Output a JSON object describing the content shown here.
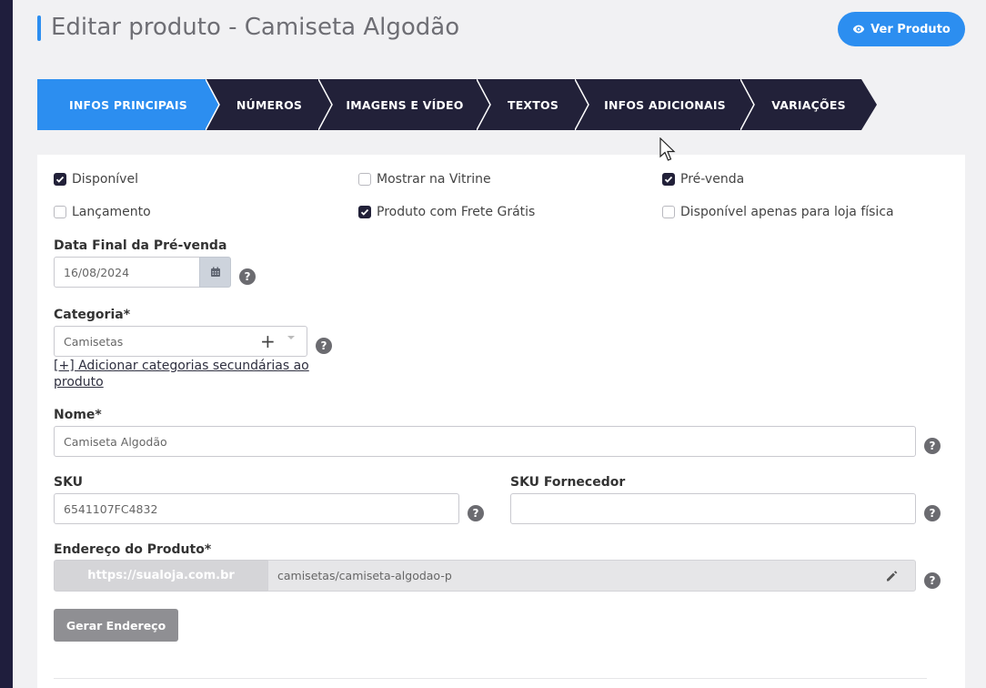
{
  "header": {
    "title": "Editar produto - Camiseta Algodão",
    "view_button": "Ver Produto"
  },
  "steps": [
    {
      "label": "INFOS PRINCIPAIS",
      "active": true
    },
    {
      "label": "NÚMEROS",
      "active": false
    },
    {
      "label": "IMAGENS E VÍDEO",
      "active": false
    },
    {
      "label": "TEXTOS",
      "active": false
    },
    {
      "label": "INFOS ADICIONAIS",
      "active": false
    },
    {
      "label": "VARIAÇÕES",
      "active": false
    }
  ],
  "checkboxes": [
    {
      "label": "Disponível",
      "checked": true
    },
    {
      "label": "Mostrar na Vitrine",
      "checked": false
    },
    {
      "label": "Pré-venda",
      "checked": true
    },
    {
      "label": "Lançamento",
      "checked": false
    },
    {
      "label": "Produto com Frete Grátis",
      "checked": true
    },
    {
      "label": "Disponível apenas para loja física",
      "checked": false
    }
  ],
  "presale": {
    "label": "Data Final da Pré-venda",
    "value": "16/08/2024"
  },
  "category": {
    "label": "Categoria*",
    "value": "Camisetas",
    "add_secondary_link": "[+] Adicionar categorias secundárias ao produto"
  },
  "name": {
    "label": "Nome*",
    "value": "Camiseta Algodão"
  },
  "sku": {
    "label": "SKU",
    "value": "6541107FC4832"
  },
  "sku_supplier": {
    "label": "SKU Fornecedor",
    "value": ""
  },
  "address": {
    "label": "Endereço do Produto*",
    "prefix": "https://sualoja.com.br",
    "value": "camisetas/camiseta-algodao-p"
  },
  "generate_button": "Gerar Endereço",
  "help_glyph": "?",
  "colors": {
    "accent": "#2c8ef0",
    "dark": "#222139",
    "step_active": "#2c8ef0"
  }
}
